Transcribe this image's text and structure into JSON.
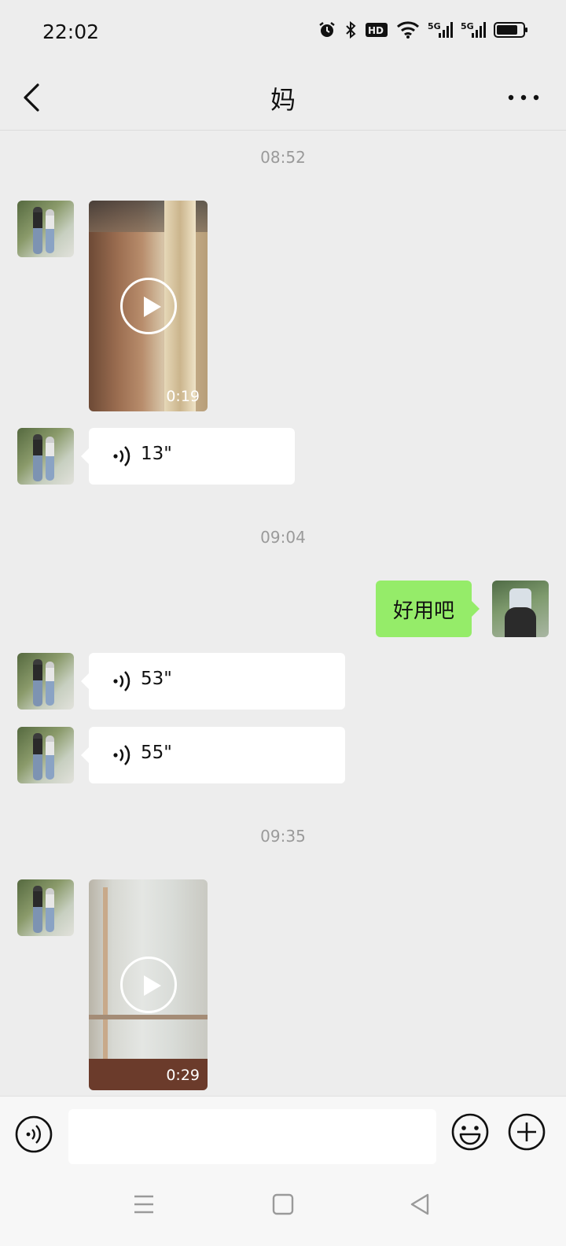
{
  "status_bar": {
    "time": "22:02",
    "icons": [
      "alarm-icon",
      "bluetooth-icon",
      "hd-icon",
      "wifi-icon",
      "5g-signal-icon",
      "5g-signal-icon",
      "battery-icon"
    ],
    "network_label_1": "5G",
    "network_label_2": "5G",
    "hd_label": "HD"
  },
  "header": {
    "title": "妈",
    "back_icon": "chevron-left-icon",
    "more_icon": "more-dots-icon"
  },
  "chat": {
    "timestamps": [
      "08:52",
      "09:04",
      "09:35"
    ],
    "messages": [
      {
        "type": "video",
        "sender": "other",
        "duration": "0:19"
      },
      {
        "type": "voice",
        "sender": "other",
        "length": "13\""
      },
      {
        "type": "text",
        "sender": "self",
        "text": "好用吧"
      },
      {
        "type": "voice",
        "sender": "other",
        "length": "53\""
      },
      {
        "type": "voice",
        "sender": "other",
        "length": "55\""
      },
      {
        "type": "video",
        "sender": "other",
        "duration": "0:29"
      }
    ]
  },
  "input_bar": {
    "value": "",
    "voice_icon": "voice-toggle-icon",
    "emoji_icon": "emoji-icon",
    "plus_icon": "plus-circle-icon"
  },
  "nav_bar": {
    "icons": [
      "menu-icon",
      "home-square-icon",
      "back-triangle-icon"
    ]
  },
  "colors": {
    "background": "#ededed",
    "self_bubble": "#95ec69",
    "other_bubble": "#ffffff",
    "timestamp": "#9a9a9a"
  }
}
